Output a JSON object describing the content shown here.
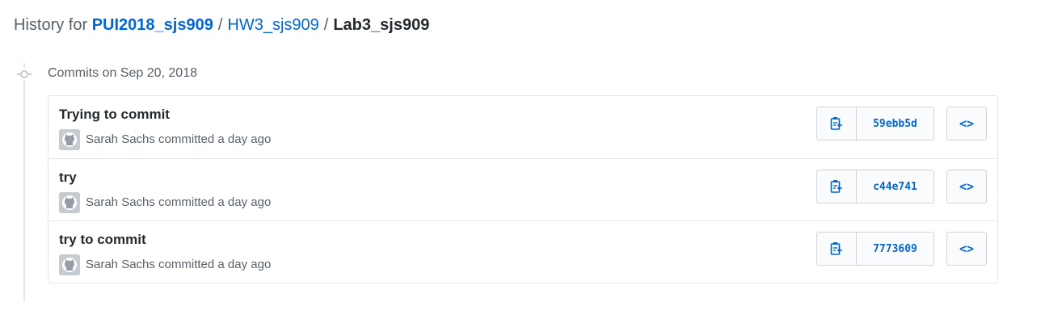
{
  "breadcrumb": {
    "prefix": "History for",
    "repo": "PUI2018_sjs909",
    "separator": "/",
    "folder": "HW3_sjs909",
    "file": "Lab3_sjs909"
  },
  "group": {
    "title": "Commits on Sep 20, 2018"
  },
  "commits": [
    {
      "title": "Trying to commit",
      "meta": "Sarah Sachs committed a day ago",
      "sha": "59ebb5d",
      "browse_label": "<>"
    },
    {
      "title": "try",
      "meta": "Sarah Sachs committed a day ago",
      "sha": "c44e741",
      "browse_label": "<>"
    },
    {
      "title": "try to commit",
      "meta": "Sarah Sachs committed a day ago",
      "sha": "7773609",
      "browse_label": "<>"
    }
  ],
  "icons": {
    "copy": "clippy-icon",
    "node": "git-commit-icon",
    "avatar": "github-avatar-icon"
  },
  "colors": {
    "link": "#0366d6",
    "muted": "#586069",
    "text": "#24292e",
    "border": "#e1e4e8"
  }
}
